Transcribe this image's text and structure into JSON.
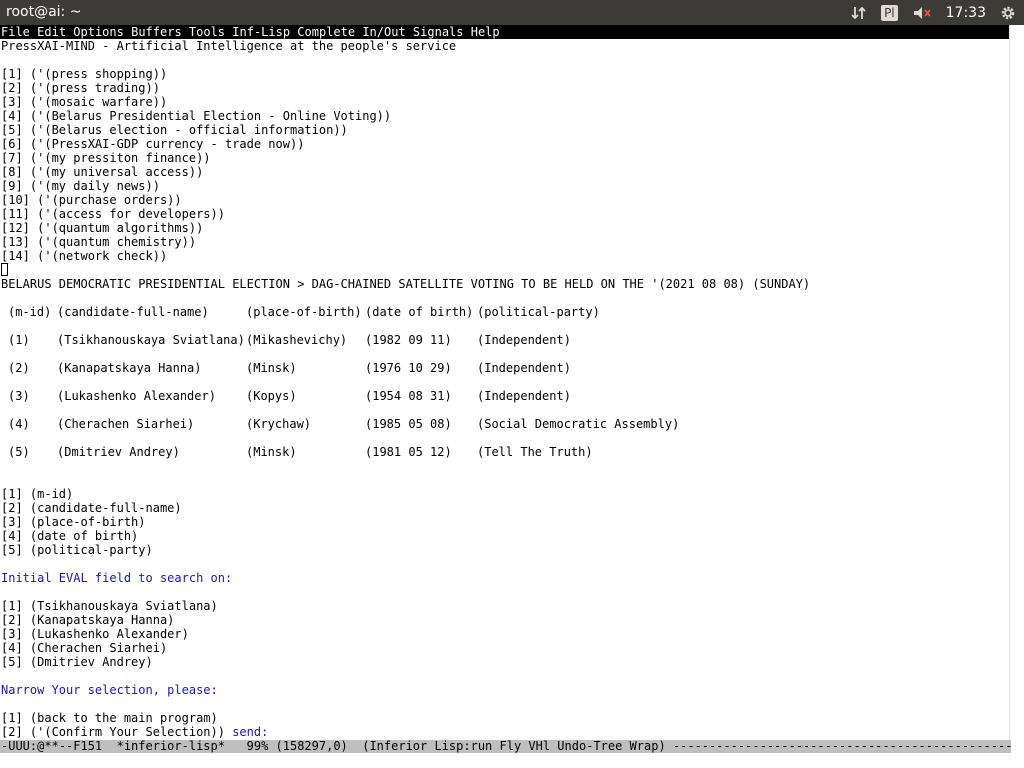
{
  "window": {
    "title": "root@ai: ~",
    "tray": {
      "keyboard_layout": "Pl",
      "clock": "17:33"
    }
  },
  "menu": [
    "File",
    "Edit",
    "Options",
    "Buffers",
    "Tools",
    "Inf-Lisp",
    "Complete",
    "In/Out",
    "Signals",
    "Help"
  ],
  "header": "PressXAI-MIND - Artificial Intelligence at the people's service",
  "main_menu": [
    "[1] ('(press shopping))",
    "[2] ('(press trading))",
    "[3] ('(mosaic warfare))",
    "[4] ('(Belarus Presidential Election - Online Voting))",
    "[5] ('(Belarus election - official information))",
    "[6] ('(PressXAI-GDP currency - trade now))",
    "[7] ('(my pressiton finance))",
    "[8] ('(my universal access))",
    "[9] ('(my daily news))",
    "[10] ('(purchase orders))",
    "[11] ('(access for developers))",
    "[12] ('(quantum algorithms))",
    "[13] ('(quantum chemistry))",
    "[14] ('(network check))"
  ],
  "election_heading": "BELARUS DEMOCRATIC PRESIDENTIAL ELECTION > DAG-CHAINED SATELLITE VOTING TO BE HELD ON THE '(2021 08 08) (SUNDAY)",
  "table": {
    "columns": [
      "(m-id)",
      "(candidate-full-name)",
      "(place-of-birth)",
      "(date of birth)",
      "(political-party)"
    ],
    "rows": [
      [
        "(1)",
        "(Tsikhanouskaya Sviatlana)",
        "(Mikashevichy)",
        "(1982 09 11)",
        "(Independent)"
      ],
      [
        "(2)",
        "(Kanapatskaya Hanna)",
        "(Minsk)",
        "(1976 10 29)",
        "(Independent)"
      ],
      [
        "(3)",
        "(Lukashenko Alexander)",
        "(Kopys)",
        "(1954 08 31)",
        "(Independent)"
      ],
      [
        "(4)",
        "(Cherachen Siarhei)",
        "(Krychaw)",
        "(1985 05 08)",
        "(Social Democratic Assembly)"
      ],
      [
        "(5)",
        "(Dmitriev Andrey)",
        "(Minsk)",
        "(1981 05 12)",
        "(Tell The Truth)"
      ]
    ]
  },
  "field_options": [
    "[1] (m-id)",
    "[2] (candidate-full-name)",
    "[3] (place-of-birth)",
    "[4] (date of birth)",
    "[5] (political-party)"
  ],
  "eval_prompt": "Initial EVAL field to search on:",
  "candidate_options": [
    "[1] (Tsikhanouskaya Sviatlana)",
    "[2] (Kanapatskaya Hanna)",
    "[3] (Lukashenko Alexander)",
    "[4] (Cherachen Siarhei)",
    "[5] (Dmitriev Andrey)"
  ],
  "narrow_prompt": "Narrow Your selection, please:",
  "final_options": {
    "back": "[1] (back to the main program)",
    "confirm": "[2] ('(Confirm Your Selection))",
    "send": " send:"
  },
  "modeline": "-UUU:@**--F151  *inferior-lisp*   99% (158297,0)  (Inferior Lisp:run Fly VHl Undo-Tree Wrap) -----------------------------------------------------------------",
  "colors": {
    "prompt_blue": "#1a1aa6",
    "topbar": "#3c3b37",
    "modeline": "#bfbfbf"
  }
}
